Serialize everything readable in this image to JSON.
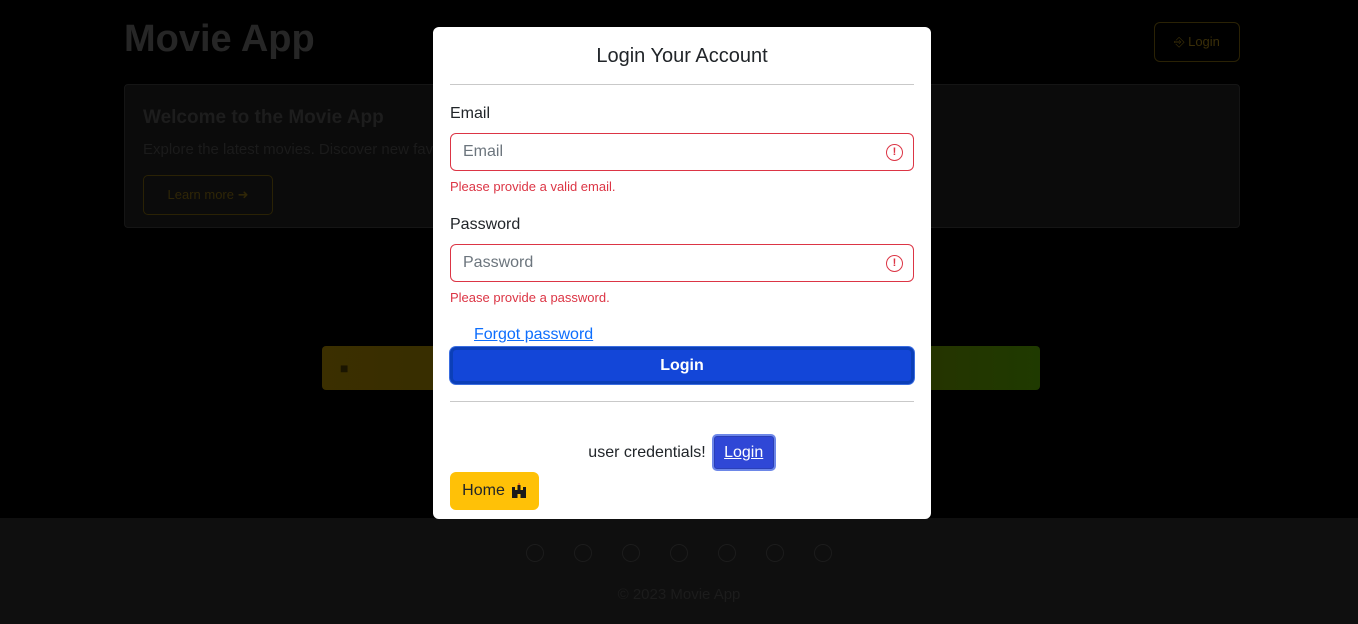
{
  "background": {
    "brand": "Movie App",
    "header_login": "⎆ Login",
    "card_title": "Welcome to the Movie App",
    "card_subtitle": "Explore the latest movies. Discover new favorites.",
    "card_button": "Learn more ➜",
    "banner_text": "■ ",
    "copyright": "© 2023 Movie App"
  },
  "modal": {
    "title": "Login Your Account",
    "email_label": "Email",
    "email_placeholder": "Email",
    "email_feedback": "Please provide a valid email.",
    "password_label": "Password",
    "password_placeholder": "Password",
    "password_feedback": "Please provide a password.",
    "forgot_link": "Forgot password",
    "login_button": "Login",
    "credentials_text": "user credentials!",
    "credentials_button": "Login",
    "home_button": "Home"
  },
  "icons": {
    "error": "exclamation-circle-icon",
    "home": "castle-icon"
  },
  "colors": {
    "primary": "#1346d8",
    "danger": "#dc3545",
    "warning": "#ffc107",
    "link": "#0d6efd"
  }
}
